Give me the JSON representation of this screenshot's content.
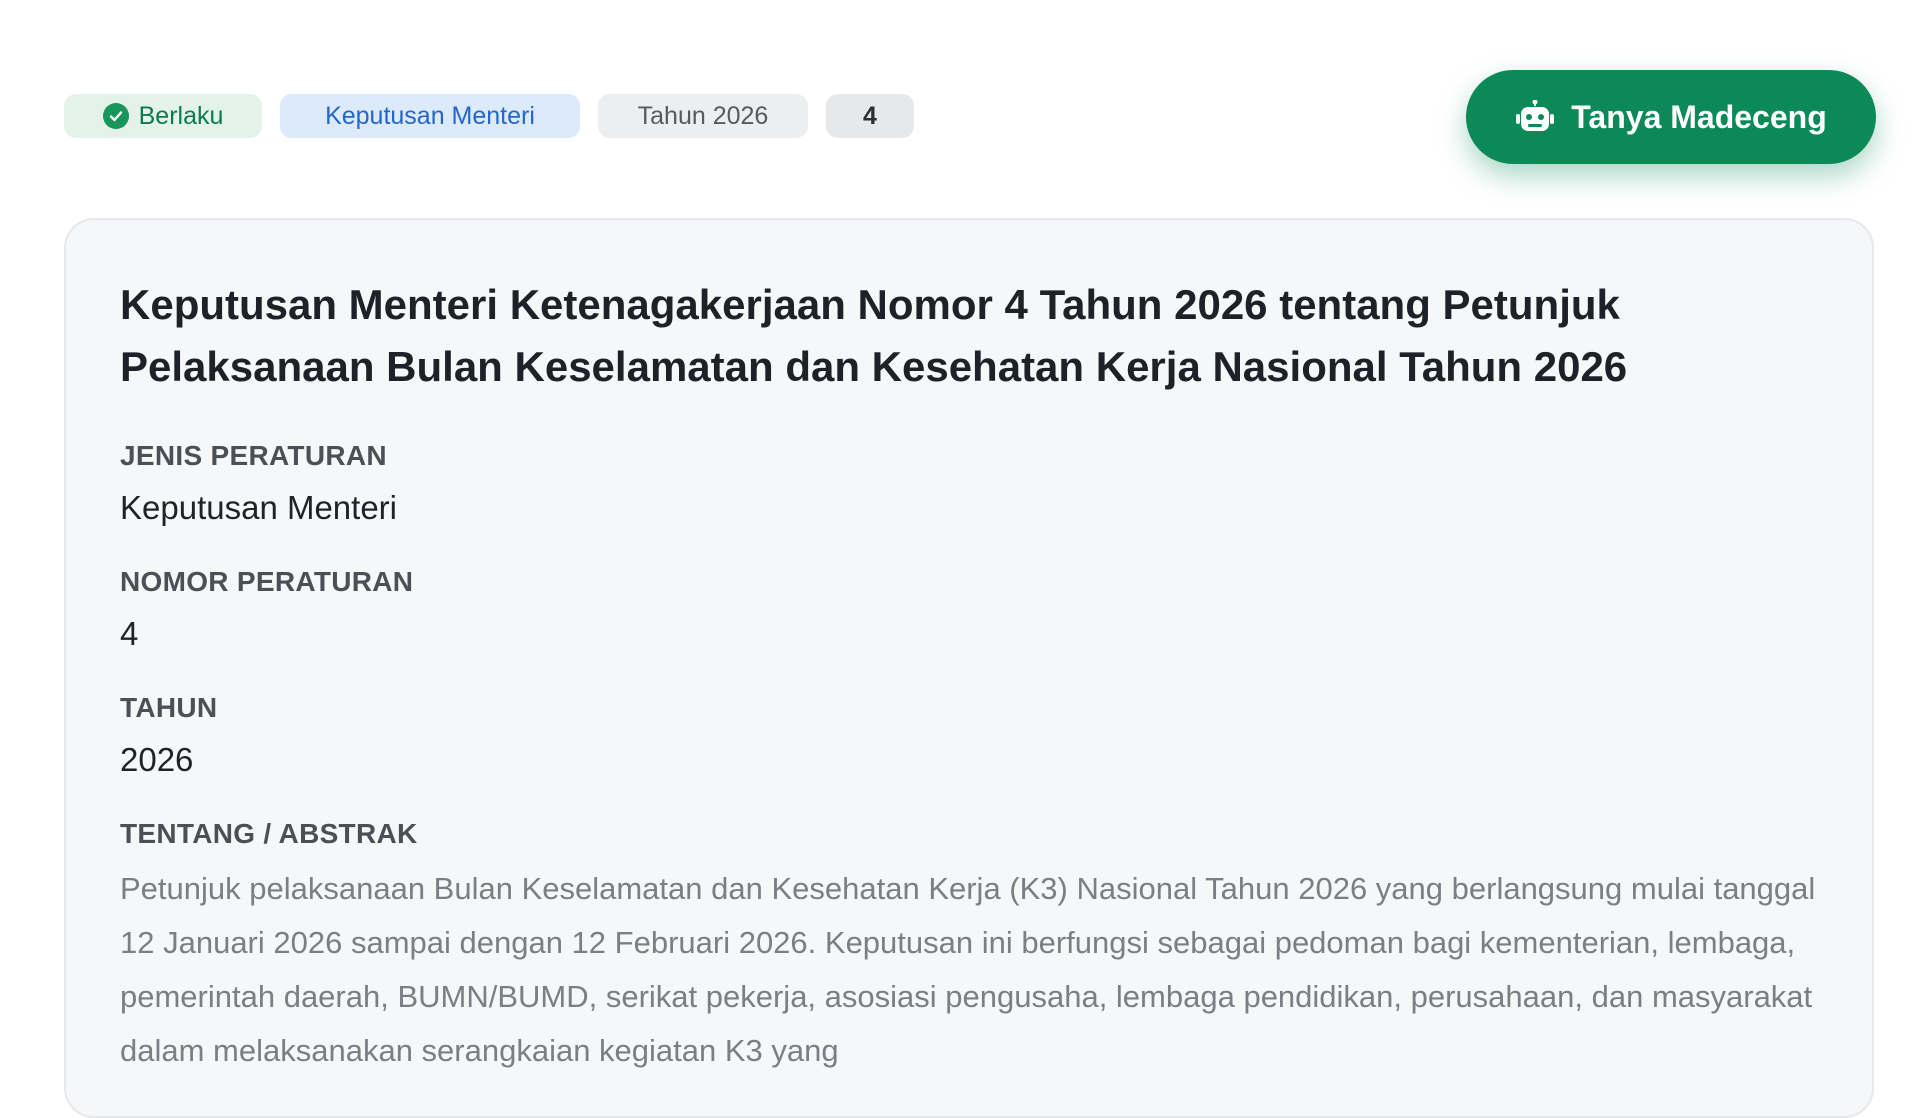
{
  "badges": {
    "status": "Berlaku",
    "type": "Keputusan Menteri",
    "year": "Tahun 2026",
    "number": "4"
  },
  "ask_button": {
    "label": "Tanya Madeceng",
    "icon": "robot-icon"
  },
  "document": {
    "title": "Keputusan Menteri Ketenagakerjaan Nomor 4 Tahun 2026 tentang Petunjuk Pelaksanaan Bulan Keselamatan dan Kesehatan Kerja Nasional Tahun 2026",
    "fields": {
      "type_label": "JENIS PERATURAN",
      "type_value": "Keputusan Menteri",
      "number_label": "NOMOR PERATURAN",
      "number_value": "4",
      "year_label": "TAHUN",
      "year_value": "2026",
      "abstract_label": "TENTANG / ABSTRAK",
      "abstract_value": "Petunjuk pelaksanaan Bulan Keselamatan dan Kesehatan Kerja (K3) Nasional Tahun 2026 yang berlangsung mulai tanggal 12 Januari 2026 sampai dengan 12 Februari 2026. Keputusan ini berfungsi sebagai pedoman bagi kementerian, lembaga, pemerintah daerah, BUMN/BUMD, serikat pekerja, asosiasi pengusaha, lembaga pendidikan, perusahaan, dan masyarakat dalam melaksanakan serangkaian kegiatan K3 yang"
    }
  },
  "colors": {
    "brand_green": "#0b8a58",
    "status_bg": "#e3f3ea",
    "type_bg": "#dceafc",
    "type_text": "#2466c9"
  }
}
